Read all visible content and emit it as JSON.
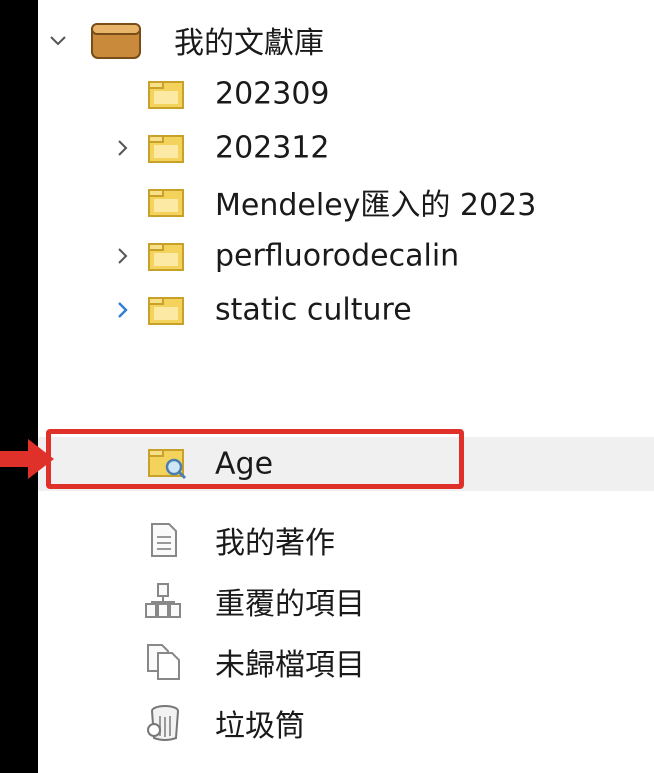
{
  "library": {
    "root": {
      "label": "我的文獻庫",
      "icon": "library-icon",
      "expanded": true
    },
    "items": [
      {
        "label": "202309",
        "icon": "folder-icon",
        "has_children": false
      },
      {
        "label": "202312",
        "icon": "folder-icon",
        "has_children": true
      },
      {
        "label": "Mendeley匯入的 2023",
        "icon": "folder-icon",
        "has_children": false
      },
      {
        "label": "perfluorodecalin",
        "icon": "folder-icon",
        "has_children": true
      },
      {
        "label": "static culture",
        "icon": "folder-icon",
        "has_children": true
      },
      {
        "label": "Age",
        "icon": "saved-search-icon",
        "has_children": false,
        "selected": true
      },
      {
        "label": "我的著作",
        "icon": "document-icon",
        "has_children": false
      },
      {
        "label": "重覆的項目",
        "icon": "duplicate-items-icon",
        "has_children": false
      },
      {
        "label": "未歸檔項目",
        "icon": "unfiled-items-icon",
        "has_children": false
      },
      {
        "label": "垃圾筒",
        "icon": "trash-icon",
        "has_children": false
      }
    ]
  },
  "colors": {
    "annotation_red": "#e0302a",
    "chevron_blue": "#2f7fd8",
    "folder_yellow": "#f3d35c"
  }
}
